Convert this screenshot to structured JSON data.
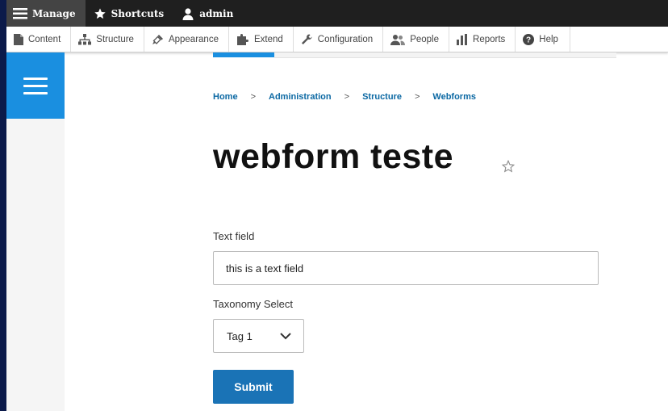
{
  "toolbar": {
    "manage_label": "Manage",
    "shortcuts_label": "Shortcuts",
    "user_label": "admin"
  },
  "admin_menu": {
    "items": [
      {
        "label": "Content",
        "icon": "document-icon"
      },
      {
        "label": "Structure",
        "icon": "sitemap-icon"
      },
      {
        "label": "Appearance",
        "icon": "paint-brush-icon"
      },
      {
        "label": "Extend",
        "icon": "puzzle-icon"
      },
      {
        "label": "Configuration",
        "icon": "wrench-icon"
      },
      {
        "label": "People",
        "icon": "people-icon"
      },
      {
        "label": "Reports",
        "icon": "bar-chart-icon"
      },
      {
        "label": "Help",
        "icon": "help-icon"
      }
    ]
  },
  "breadcrumb": {
    "items": [
      "Home",
      "Administration",
      "Structure",
      "Webforms"
    ],
    "separator": ">"
  },
  "page": {
    "title": "webform teste"
  },
  "form": {
    "text_field_label": "Text field",
    "text_field_value": "this is a text field",
    "taxonomy_label": "Taxonomy Select",
    "taxonomy_value": "Tag 1",
    "submit_label": "Submit"
  },
  "colors": {
    "accent": "#1a8fe0",
    "link": "#0b68a3",
    "submit": "#1a73b6"
  }
}
